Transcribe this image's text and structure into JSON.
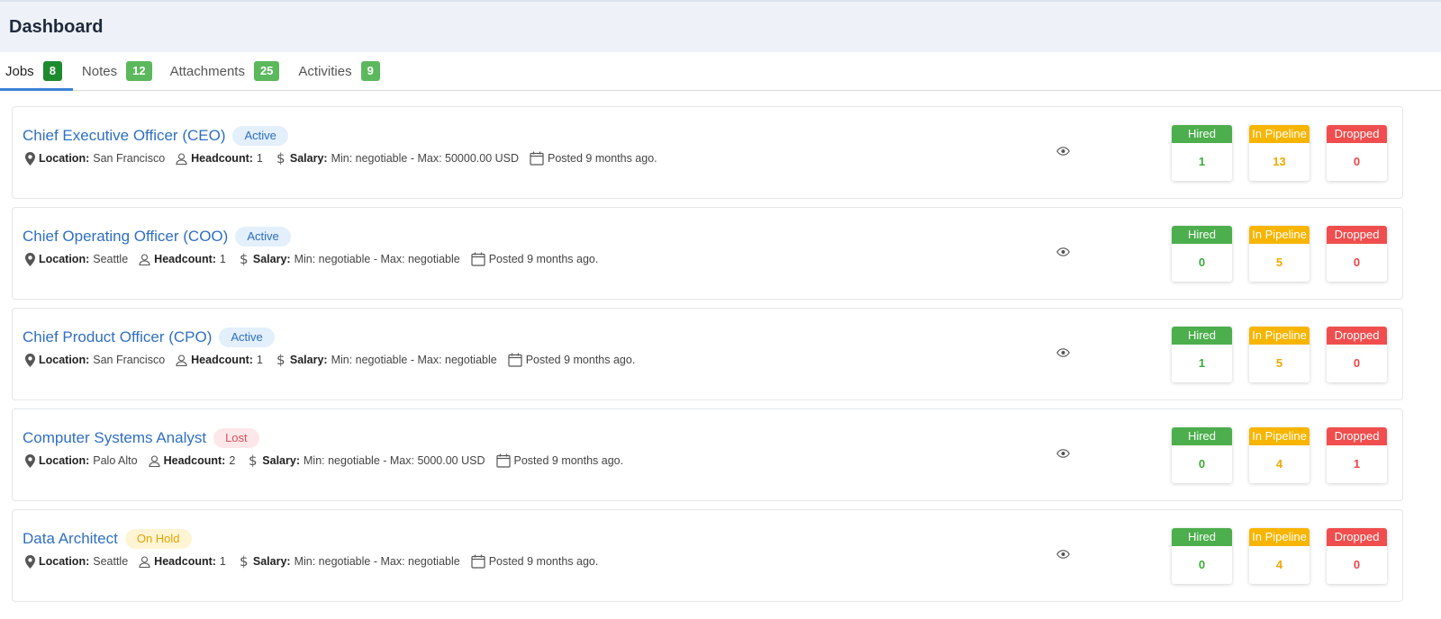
{
  "header": {
    "title": "Dashboard"
  },
  "tabs": [
    {
      "label": "Jobs",
      "count": "8",
      "active": true
    },
    {
      "label": "Notes",
      "count": "12"
    },
    {
      "label": "Attachments",
      "count": "25"
    },
    {
      "label": "Activities",
      "count": "9"
    }
  ],
  "labels": {
    "location": "Location:",
    "headcount": "Headcount:",
    "salary": "Salary:",
    "hired": "Hired",
    "pipeline": "In Pipeline",
    "dropped": "Dropped"
  },
  "colors": {
    "accent": "#3b82d6",
    "title_link": "#2f6fc2",
    "hired": "#4cae4c",
    "pipeline": "#f7b500",
    "dropped": "#f04e4e"
  },
  "jobs": [
    {
      "title": "Chief Executive Officer (CEO)",
      "status": "Active",
      "location": "San Francisco",
      "headcount": "1",
      "salary": "Min: negotiable - Max: 50000.00 USD",
      "posted": "Posted 9 months ago.",
      "hired": "1",
      "pipeline": "13",
      "dropped": "0"
    },
    {
      "title": "Chief Operating Officer (COO)",
      "status": "Active",
      "location": "Seattle",
      "headcount": "1",
      "salary": "Min: negotiable - Max: negotiable",
      "posted": "Posted 9 months ago.",
      "hired": "0",
      "pipeline": "5",
      "dropped": "0"
    },
    {
      "title": "Chief Product Officer (CPO)",
      "status": "Active",
      "location": "San Francisco",
      "headcount": "1",
      "salary": "Min: negotiable - Max: negotiable",
      "posted": "Posted 9 months ago.",
      "hired": "1",
      "pipeline": "5",
      "dropped": "0"
    },
    {
      "title": "Computer Systems Analyst",
      "status": "Lost",
      "location": "Palo Alto",
      "headcount": "2",
      "salary": "Min: negotiable - Max: 5000.00 USD",
      "posted": "Posted 9 months ago.",
      "hired": "0",
      "pipeline": "4",
      "dropped": "1"
    },
    {
      "title": "Data Architect",
      "status": "On Hold",
      "location": "Seattle",
      "headcount": "1",
      "salary": "Min: negotiable - Max: negotiable",
      "posted": "Posted 9 months ago.",
      "hired": "0",
      "pipeline": "4",
      "dropped": "0"
    }
  ]
}
